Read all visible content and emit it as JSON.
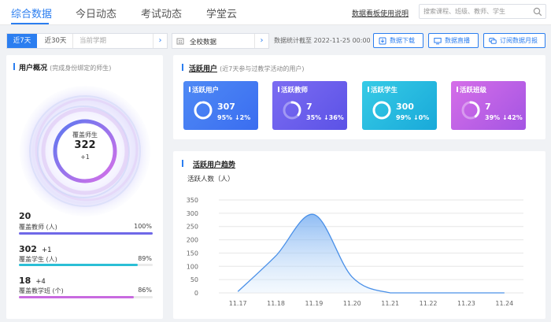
{
  "nav": {
    "tabs": [
      {
        "label": "综合数据",
        "active": true
      },
      {
        "label": "今日动态",
        "active": false
      },
      {
        "label": "考试动态",
        "active": false
      },
      {
        "label": "学堂云",
        "active": false
      }
    ],
    "guide_link": "数据看板使用说明",
    "search_placeholder": "搜索课程、班级、教师、学生"
  },
  "toolbar": {
    "period_tabs": [
      "近7天",
      "近30天"
    ],
    "term_placeholder": "当前学期",
    "scope_label": "全校数据",
    "stat_time": "数据统计截至 2022-11-25 00:00",
    "buttons": [
      "数据下载",
      "数据直播",
      "订阅数据月报"
    ]
  },
  "overview": {
    "title": "用户概况",
    "subtitle": "(完成身份绑定的师生)",
    "ring_label": "覆盖师生",
    "ring_value": "322",
    "ring_delta": "+1",
    "metrics": [
      {
        "value": "20",
        "delta": "",
        "label": "覆盖教师 (人)",
        "percent": "100%",
        "fill": 1.0,
        "color": "#6f68e8"
      },
      {
        "value": "302",
        "delta": "+1",
        "label": "覆盖学生 (人)",
        "percent": "89%",
        "fill": 0.89,
        "color": "#2bbfd6"
      },
      {
        "value": "18",
        "delta": "+4",
        "label": "覆盖教学班 (个)",
        "percent": "86%",
        "fill": 0.86,
        "color": "#c86ae0"
      }
    ]
  },
  "active": {
    "title": "活跃用户",
    "subtitle": "(近7天参与过教学活动的用户)",
    "tiles": [
      {
        "label": "活跃用户",
        "value": "307",
        "rate": "95%",
        "change": "↓2%",
        "fraction": 0.95,
        "color_start": "#4f8af5",
        "color_end": "#3a6df0"
      },
      {
        "label": "活跃教师",
        "value": "7",
        "rate": "35%",
        "change": "↓36%",
        "fraction": 0.35,
        "color_start": "#7c6cf2",
        "color_end": "#5b52e6"
      },
      {
        "label": "活跃学生",
        "value": "300",
        "rate": "99%",
        "change": "↓0%",
        "fraction": 0.99,
        "color_start": "#36cbe6",
        "color_end": "#19a9d9"
      },
      {
        "label": "活跃班级",
        "value": "7",
        "rate": "39%",
        "change": "↓42%",
        "fraction": 0.39,
        "color_start": "#d56ee8",
        "color_end": "#a455e3"
      }
    ]
  },
  "trend": {
    "title": "活跃用户趋势"
  },
  "chart_data": {
    "type": "area",
    "title": "活跃用户趋势",
    "ylabel": "活跃人数（人）",
    "xlabel": "",
    "categories": [
      "11.17",
      "11.18",
      "11.19",
      "11.20",
      "11.21",
      "11.22",
      "11.23",
      "11.24"
    ],
    "series": [
      {
        "values": [
          5,
          140,
          295,
          60,
          0,
          0,
          0,
          0
        ]
      }
    ],
    "ylim": [
      0,
      350
    ],
    "yticks": [
      0,
      50,
      100,
      150,
      200,
      250,
      300,
      350
    ],
    "grid": true,
    "color": "#4a90e8"
  }
}
